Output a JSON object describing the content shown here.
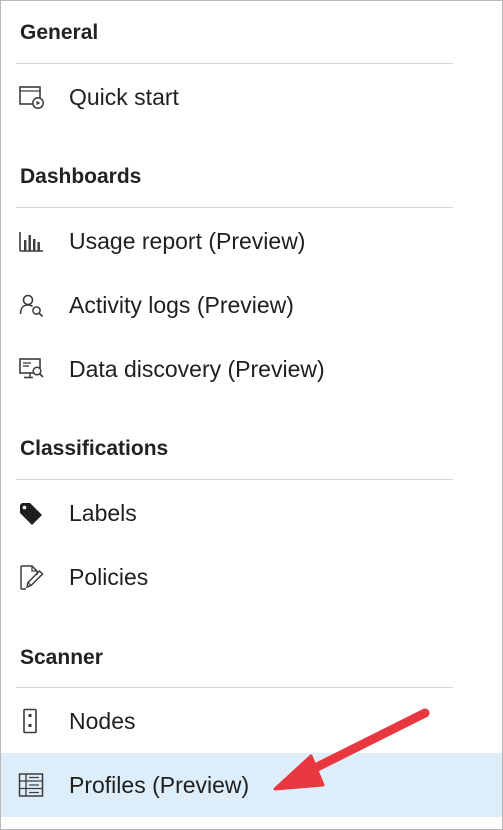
{
  "sections": [
    {
      "title": "General",
      "items": [
        {
          "label": "Quick start",
          "icon": "quick-start-icon"
        }
      ]
    },
    {
      "title": "Dashboards",
      "items": [
        {
          "label": "Usage report (Preview)",
          "icon": "bar-chart-icon"
        },
        {
          "label": "Activity logs (Preview)",
          "icon": "user-search-icon"
        },
        {
          "label": "Data discovery (Preview)",
          "icon": "monitor-search-icon"
        }
      ]
    },
    {
      "title": "Classifications",
      "items": [
        {
          "label": "Labels",
          "icon": "tag-icon"
        },
        {
          "label": "Policies",
          "icon": "policy-edit-icon"
        }
      ]
    },
    {
      "title": "Scanner",
      "items": [
        {
          "label": "Nodes",
          "icon": "node-device-icon"
        },
        {
          "label": "Profiles (Preview)",
          "icon": "profiles-list-icon",
          "selected": true
        }
      ]
    }
  ],
  "colors": {
    "selected_background": "#ddeefa",
    "annotation_arrow": "#e8373f"
  }
}
